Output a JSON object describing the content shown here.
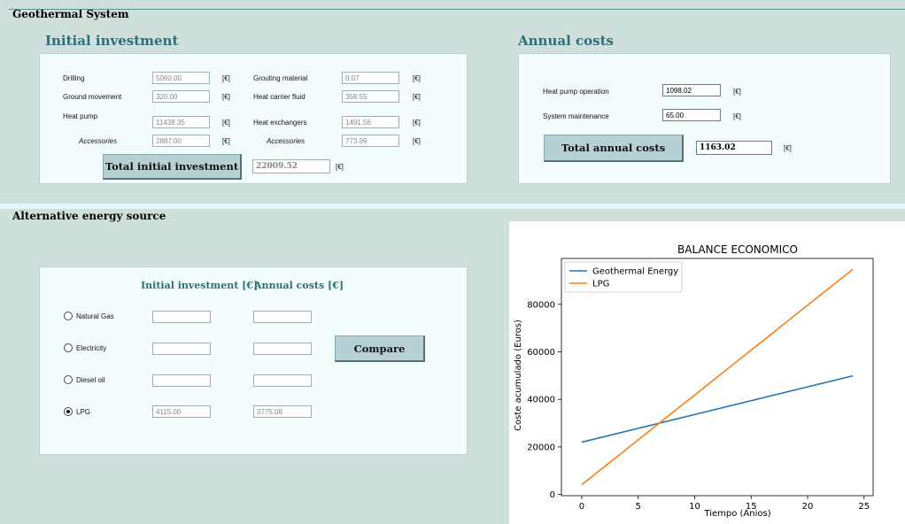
{
  "geo": {
    "section_title": "Geothermal System",
    "initial_investment": {
      "title": "Initial investment",
      "rows_left": [
        {
          "label": "Drilling",
          "value": "5060.00",
          "unit": "[€]"
        },
        {
          "label": "Ground movement",
          "value": "320.00",
          "unit": "[€]"
        },
        {
          "label": "Heat pump",
          "value": "11438.35",
          "unit": "[€]"
        },
        {
          "label": "Accessories",
          "value": "2887.00",
          "unit": "[€]"
        }
      ],
      "rows_right": [
        {
          "label": "Grouting material",
          "value": "0.07",
          "unit": "[€]"
        },
        {
          "label": "Heat carrier fluid",
          "value": "358.55",
          "unit": "[€]"
        },
        {
          "label": "Heat exchangers",
          "value": "1491.56",
          "unit": "[€]"
        },
        {
          "label": "Accessories",
          "value": "773.99",
          "unit": "[€]"
        }
      ],
      "total_button": "Total initial investment",
      "total_value": "22009.52",
      "total_unit": "[€]"
    },
    "annual_costs": {
      "title": "Annual costs",
      "rows": [
        {
          "label": "Heat pump operation",
          "value": "1098.02",
          "unit": "[€]"
        },
        {
          "label": "System maintenance",
          "value": "65.00",
          "unit": "[€]"
        }
      ],
      "total_button": "Total annual costs",
      "total_value": "1163.02",
      "total_unit": "[€]"
    }
  },
  "alt": {
    "section_title": "Alternative energy source",
    "col_investment": "Initial investment [€]",
    "col_annual": "Annual costs [€]",
    "options": [
      {
        "label": "Natural Gas",
        "selected": false,
        "investment": "",
        "annual": ""
      },
      {
        "label": "Electricity",
        "selected": false,
        "investment": "",
        "annual": ""
      },
      {
        "label": "Diesel oil",
        "selected": false,
        "investment": "",
        "annual": ""
      },
      {
        "label": "LPG",
        "selected": true,
        "investment": "4115.00",
        "annual": "3775.08"
      }
    ],
    "compare_button": "Compare"
  },
  "colors": {
    "accent_text": "#2e6e7a",
    "button_bg": "#b6d0d4",
    "series_geothermal": "#1f77b4",
    "series_lpg": "#ff7f0e"
  },
  "chart_data": {
    "type": "line",
    "title": "BALANCE ECONOMICO",
    "xlabel": "Tiempo (Anios)",
    "ylabel": "Coste acumulado (Euros)",
    "xlim": [
      -1.8,
      25.8
    ],
    "ylim": [
      -500,
      99300
    ],
    "xticks": [
      0,
      5,
      10,
      15,
      20,
      25
    ],
    "yticks": [
      0,
      20000,
      40000,
      60000,
      80000
    ],
    "legend": "top-left",
    "grid": false,
    "series": [
      {
        "name": "Geothermal Energy",
        "x": [
          0,
          24
        ],
        "y": [
          22009.52,
          49921.96
        ]
      },
      {
        "name": "LPG",
        "x": [
          0,
          24
        ],
        "y": [
          4115.0,
          94717.0
        ]
      }
    ]
  }
}
